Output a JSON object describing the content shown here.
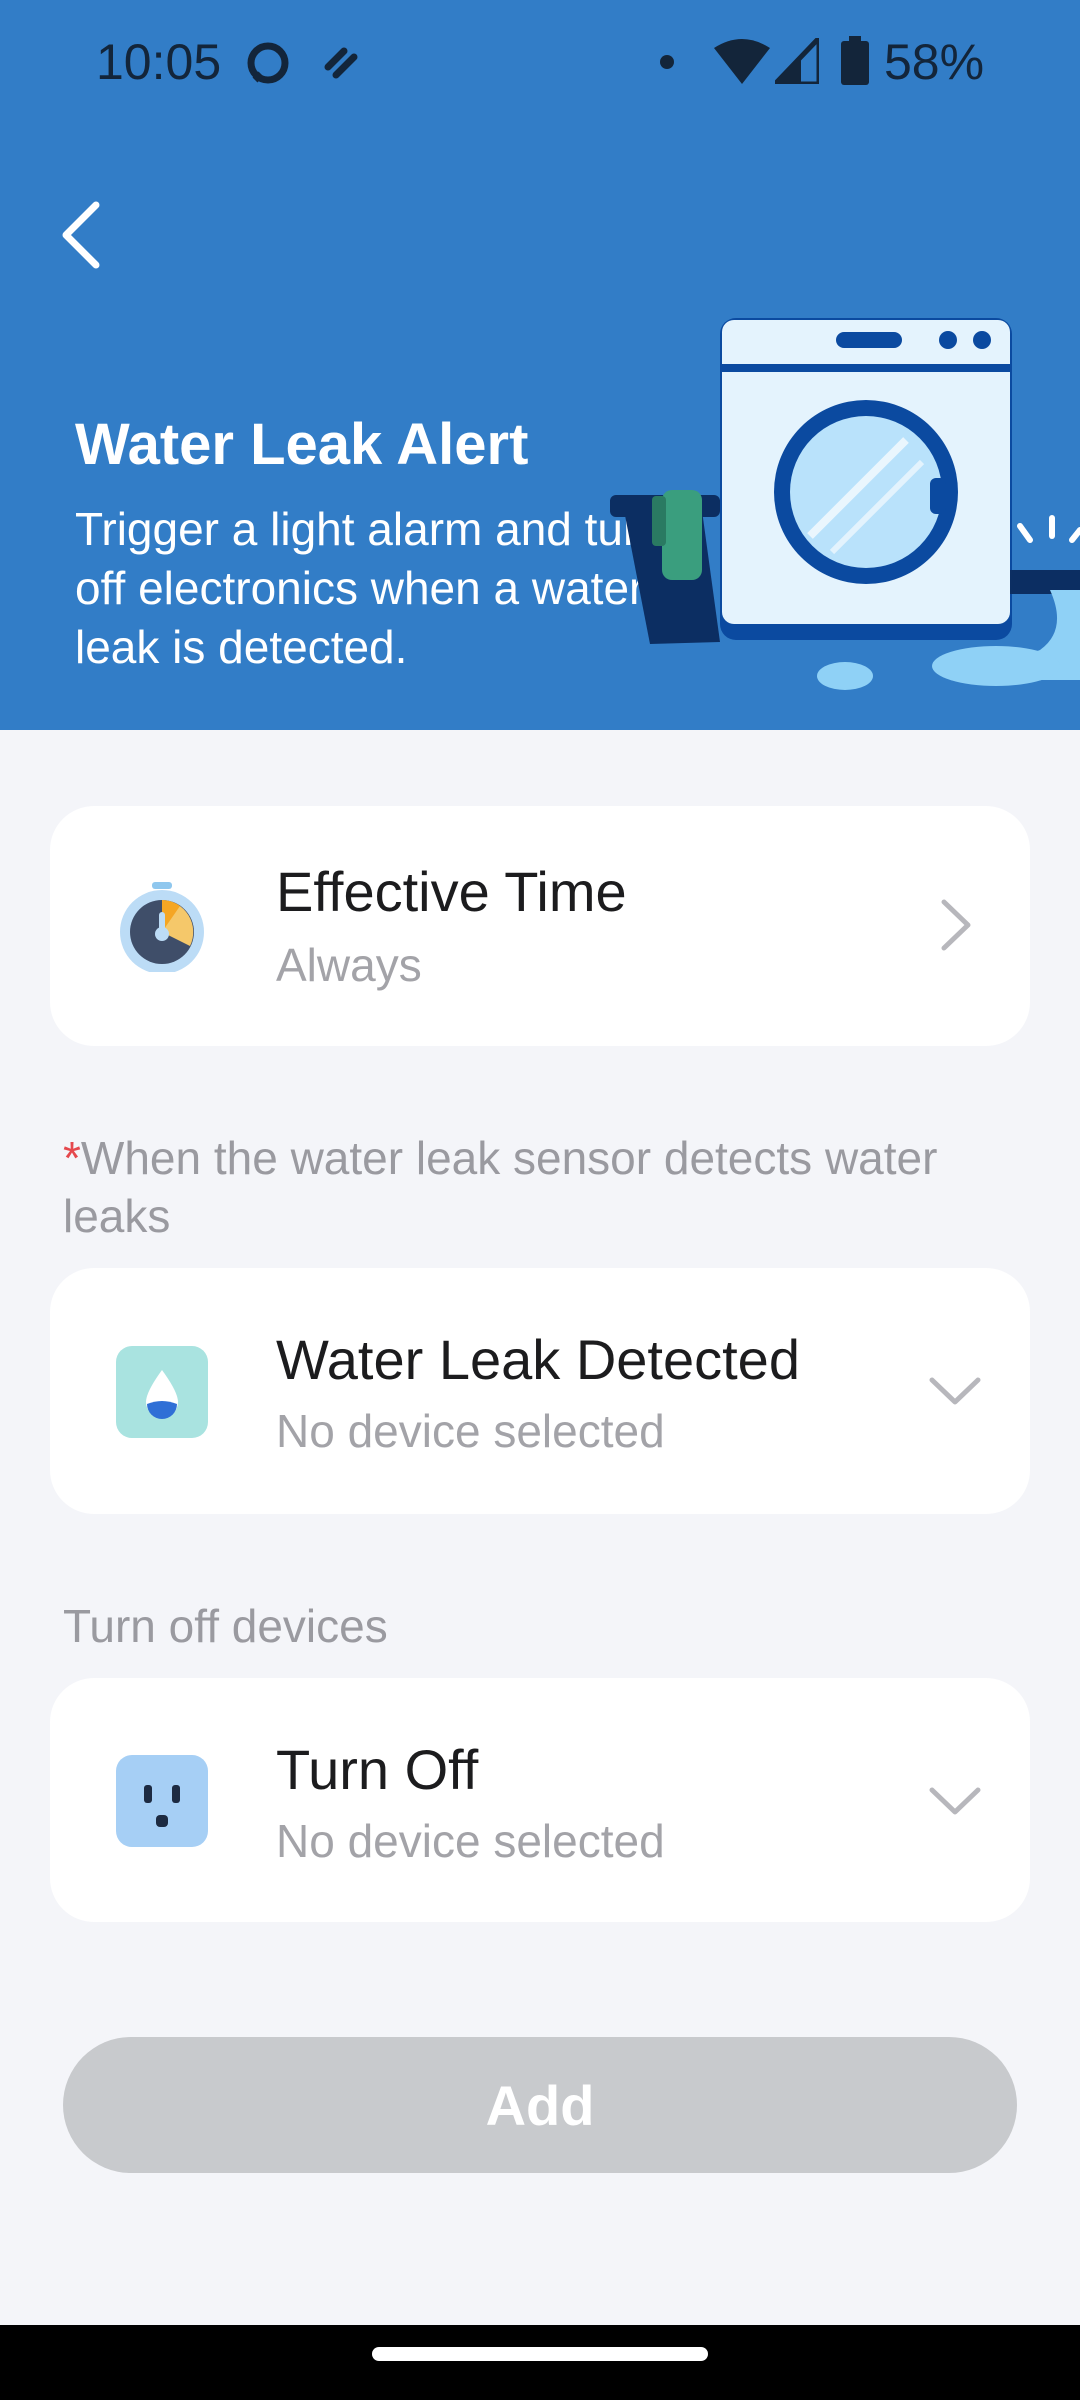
{
  "status_bar": {
    "time": "10:05",
    "battery": "58%",
    "icons": [
      "alexa-ring-icon",
      "notification-icon",
      "dot-icon",
      "wifi-icon",
      "cell-signal-icon",
      "battery-icon"
    ]
  },
  "header": {
    "title": "Water Leak Alert",
    "description": "Trigger a light alarm and turn off electronics when a water leak is detected.",
    "background_color": "#327dc7",
    "illustration": "washing-machine-leak-illustration"
  },
  "effective_time": {
    "title": "Effective Time",
    "value": "Always",
    "icon": "timer-icon"
  },
  "trigger_section": {
    "required_marker": "*",
    "label": "When the water leak sensor detects water leaks",
    "card": {
      "title": "Water Leak Detected",
      "value": "No device selected",
      "icon": "water-drop-icon"
    }
  },
  "action_section": {
    "label": "Turn off devices",
    "card": {
      "title": "Turn Off",
      "value": "No device selected",
      "icon": "smart-plug-icon"
    }
  },
  "add_button": {
    "label": "Add",
    "state": "disabled"
  },
  "colors": {
    "accent": "#327dc7",
    "required": "#e5484d",
    "disabled_button": "#c8cacd"
  }
}
